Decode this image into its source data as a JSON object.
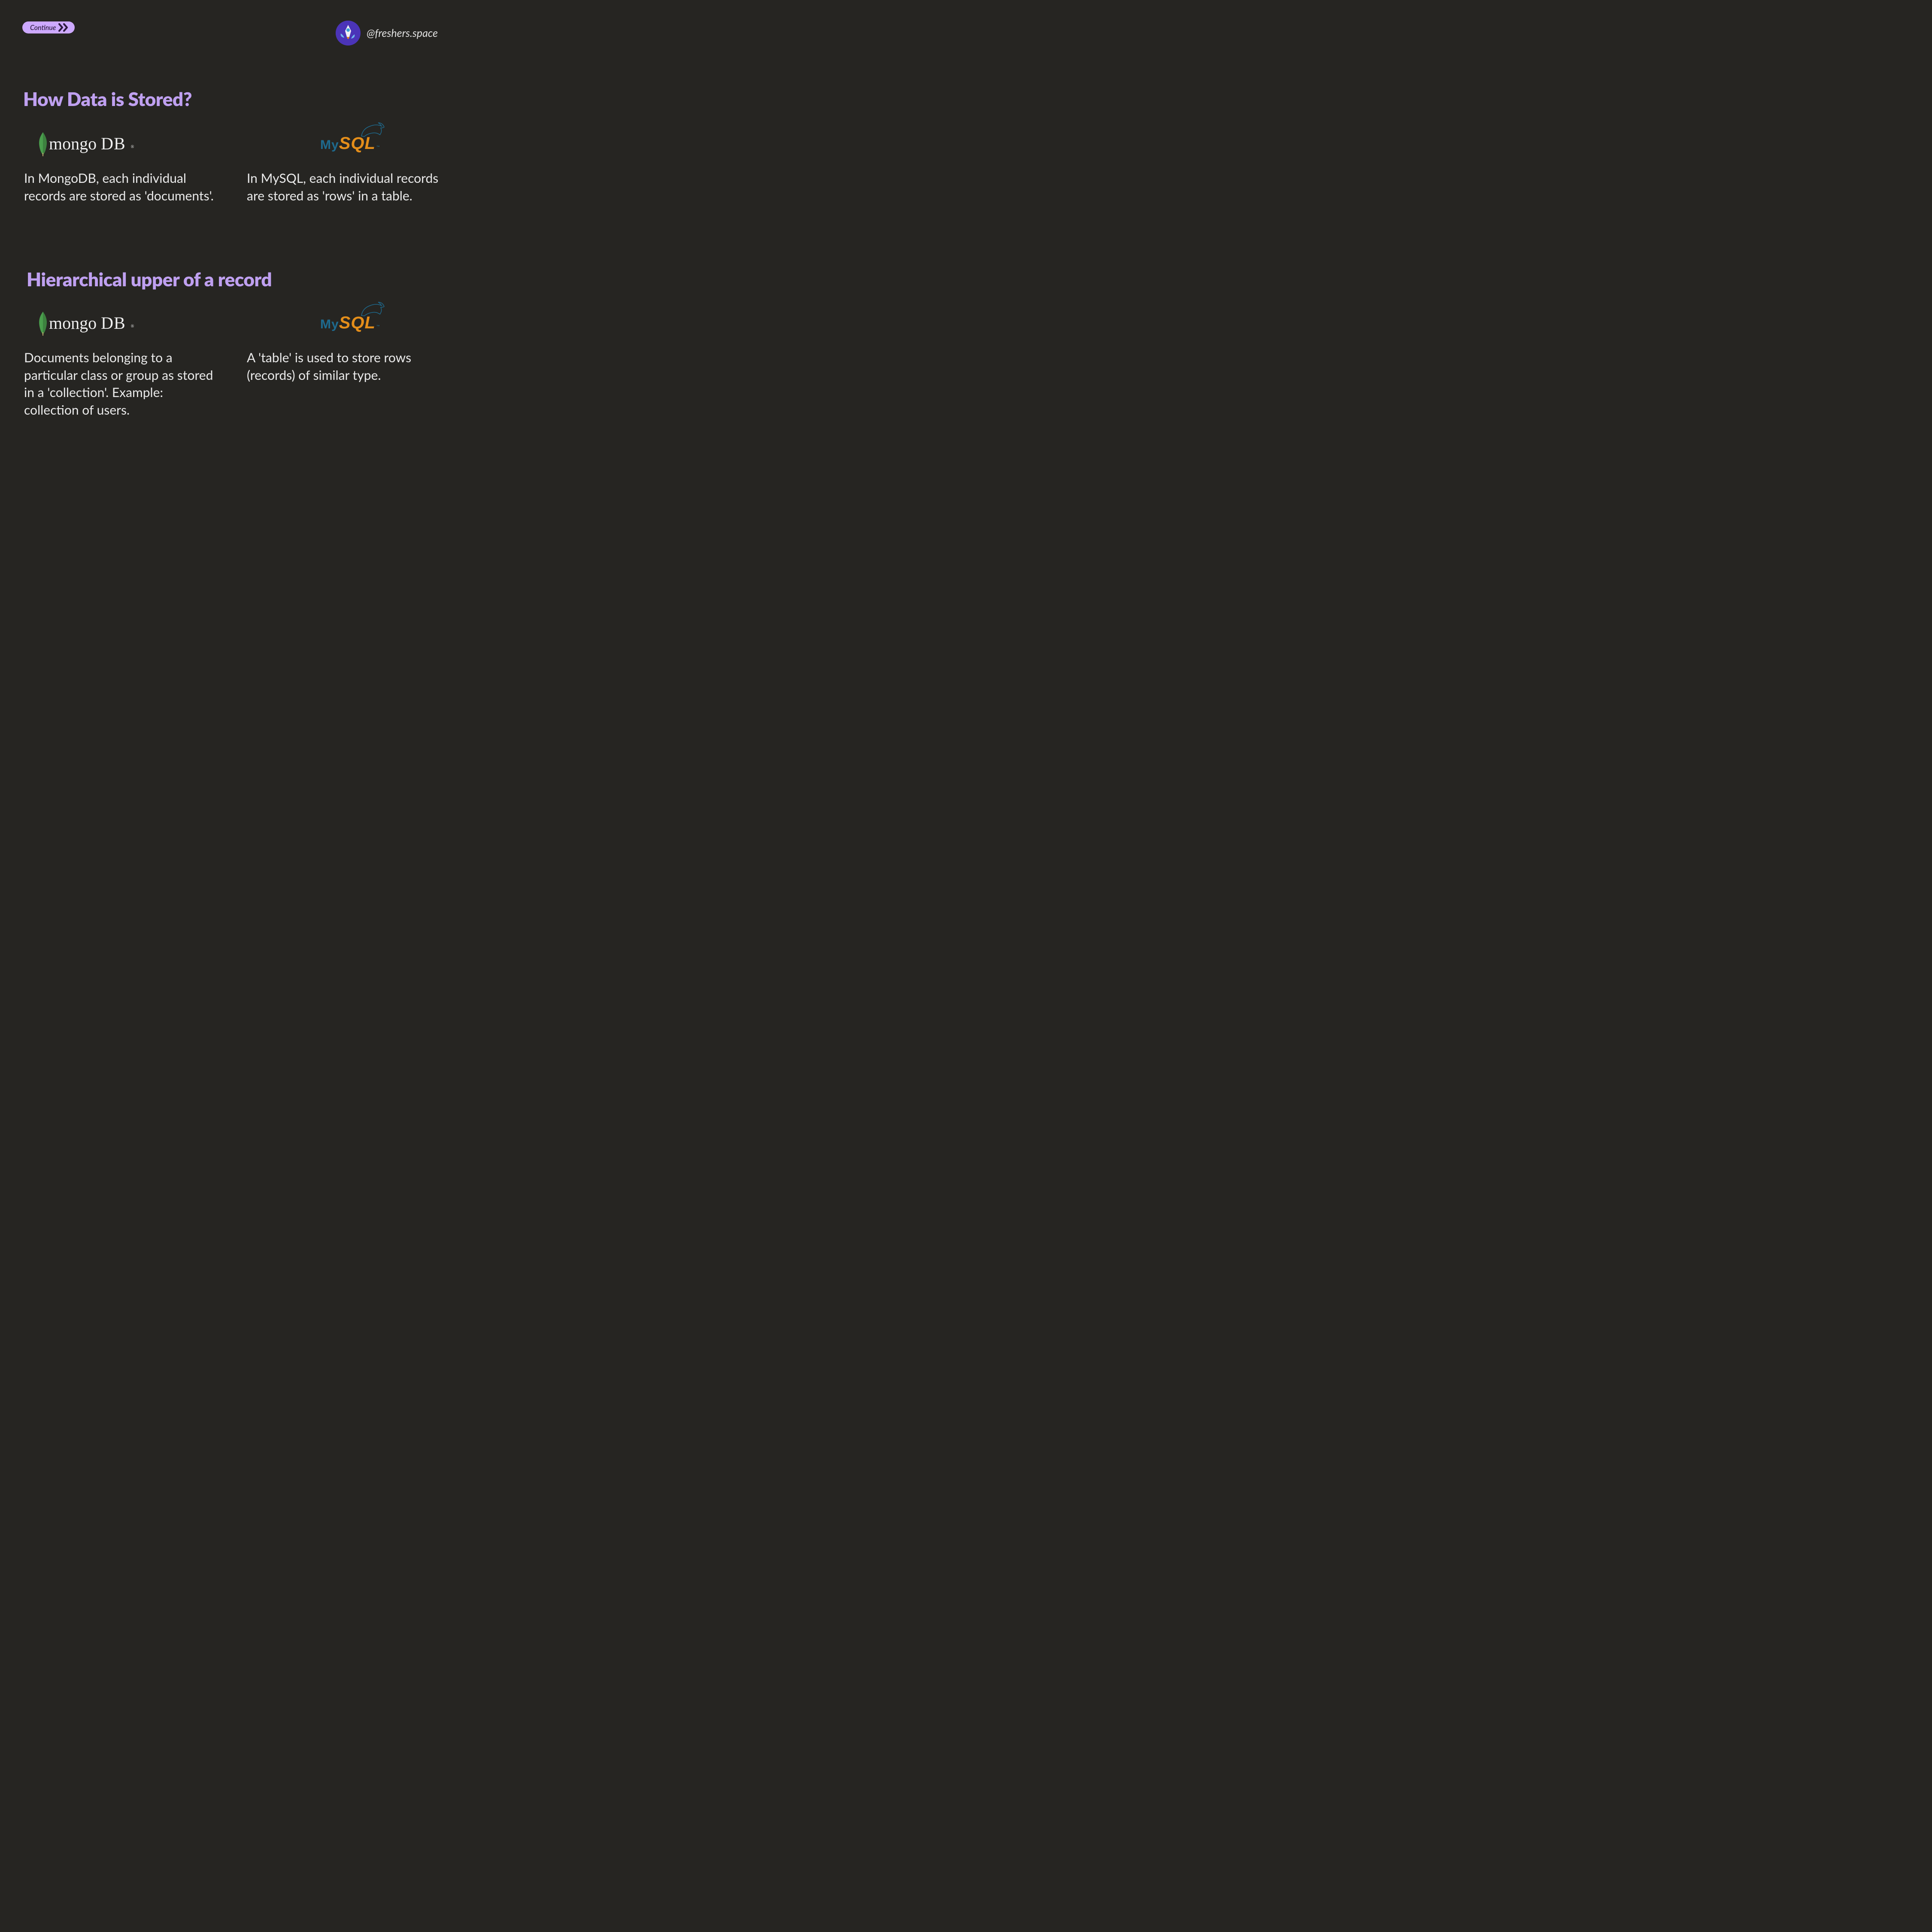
{
  "continue_label": "Continue",
  "handle": "@freshers.space",
  "sections": [
    {
      "heading": "How Data is Stored?",
      "mongo_desc": "In MongoDB, each individual records are stored as 'documents'.",
      "mysql_desc": "In MySQL, each individual records are stored as 'rows' in a table."
    },
    {
      "heading": "Hierarchical upper of a record",
      "mongo_desc": "Documents belonging to a particular class or group as stored in a 'collection'. Example: collection of users.",
      "mysql_desc": "A 'table' is used to store rows (records) of similar type."
    }
  ],
  "logos": {
    "mongo_text_a": "mongo",
    "mongo_text_b": "DB",
    "mysql_text_a": "My",
    "mysql_text_b": "SQL"
  }
}
